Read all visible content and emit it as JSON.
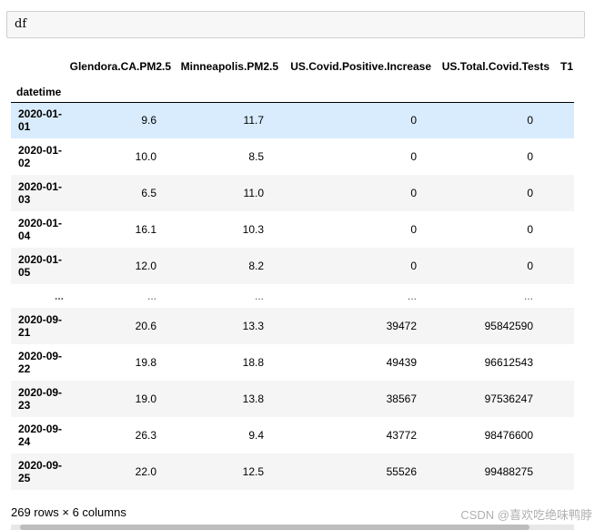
{
  "code_cell": {
    "text": "df"
  },
  "dataframe": {
    "columns": [
      "Glendora.CA.PM2.5",
      "Minneapolis.PM2.5",
      "US.Covid.Positive.Increase",
      "US.Total.Covid.Tests",
      "T1"
    ],
    "index_name": "datetime",
    "rows": [
      {
        "index": "2020-01-01",
        "values": [
          "9.6",
          "11.7",
          "0",
          "0"
        ]
      },
      {
        "index": "2020-01-02",
        "values": [
          "10.0",
          "8.5",
          "0",
          "0"
        ]
      },
      {
        "index": "2020-01-03",
        "values": [
          "6.5",
          "11.0",
          "0",
          "0"
        ]
      },
      {
        "index": "2020-01-04",
        "values": [
          "16.1",
          "10.3",
          "0",
          "0"
        ]
      },
      {
        "index": "2020-01-05",
        "values": [
          "12.0",
          "8.2",
          "0",
          "0"
        ]
      },
      {
        "index": "...",
        "values": [
          "...",
          "...",
          "...",
          "..."
        ]
      },
      {
        "index": "2020-09-21",
        "values": [
          "20.6",
          "13.3",
          "39472",
          "95842590"
        ]
      },
      {
        "index": "2020-09-22",
        "values": [
          "19.8",
          "18.8",
          "49439",
          "96612543"
        ]
      },
      {
        "index": "2020-09-23",
        "values": [
          "19.0",
          "13.8",
          "38567",
          "97536247"
        ]
      },
      {
        "index": "2020-09-24",
        "values": [
          "26.3",
          "9.4",
          "43772",
          "98476600"
        ]
      },
      {
        "index": "2020-09-25",
        "values": [
          "22.0",
          "12.5",
          "55526",
          "99488275"
        ]
      }
    ],
    "selected_row": 0,
    "summary": "269 rows × 6 columns"
  },
  "watermark": "CSDN @喜欢吃绝味鸭脖",
  "colors": {
    "selected_row": "#d9ecfd",
    "striped_row": "#f5f5f5",
    "code_bg": "#f7f7f7"
  }
}
